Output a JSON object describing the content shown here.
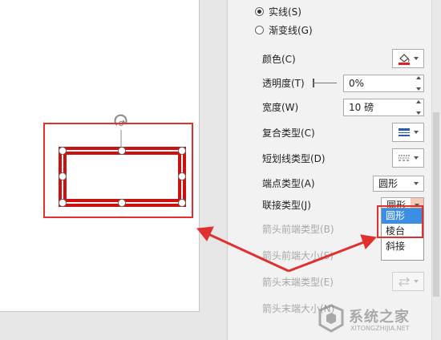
{
  "line_type_options": [
    {
      "label": "实线(S)",
      "checked": true
    },
    {
      "label": "渐变线(G)",
      "checked": false
    }
  ],
  "properties": {
    "color_label": "颜色(C)",
    "transparency_label": "透明度(T)",
    "transparency_value": "0%",
    "width_label": "宽度(W)",
    "width_value": "10 磅",
    "compound_type_label": "复合类型(C)",
    "dash_type_label": "短划线类型(D)",
    "cap_type_label": "端点类型(A)",
    "cap_type_value": "圆形",
    "join_type_label": "联接类型(J)",
    "join_type_value": "圆形",
    "begin_arrow_type_label": "箭头前端类型(B)",
    "begin_arrow_size_label": "箭头前端大小(S)",
    "end_arrow_type_label": "箭头末端类型(E)",
    "end_arrow_size_label": "箭头末端大小(N)"
  },
  "join_dropdown_options": [
    {
      "label": "圆形",
      "selected": true
    },
    {
      "label": "棱台",
      "selected": false
    },
    {
      "label": "斜接",
      "selected": false
    }
  ],
  "colors": {
    "accent_red": "#e03030",
    "shape_outline": "#cc1111",
    "selected_option": "#3c8ee3"
  },
  "watermark": {
    "text": "系统之家",
    "sub": "XITONGZHIJIA.NET"
  }
}
